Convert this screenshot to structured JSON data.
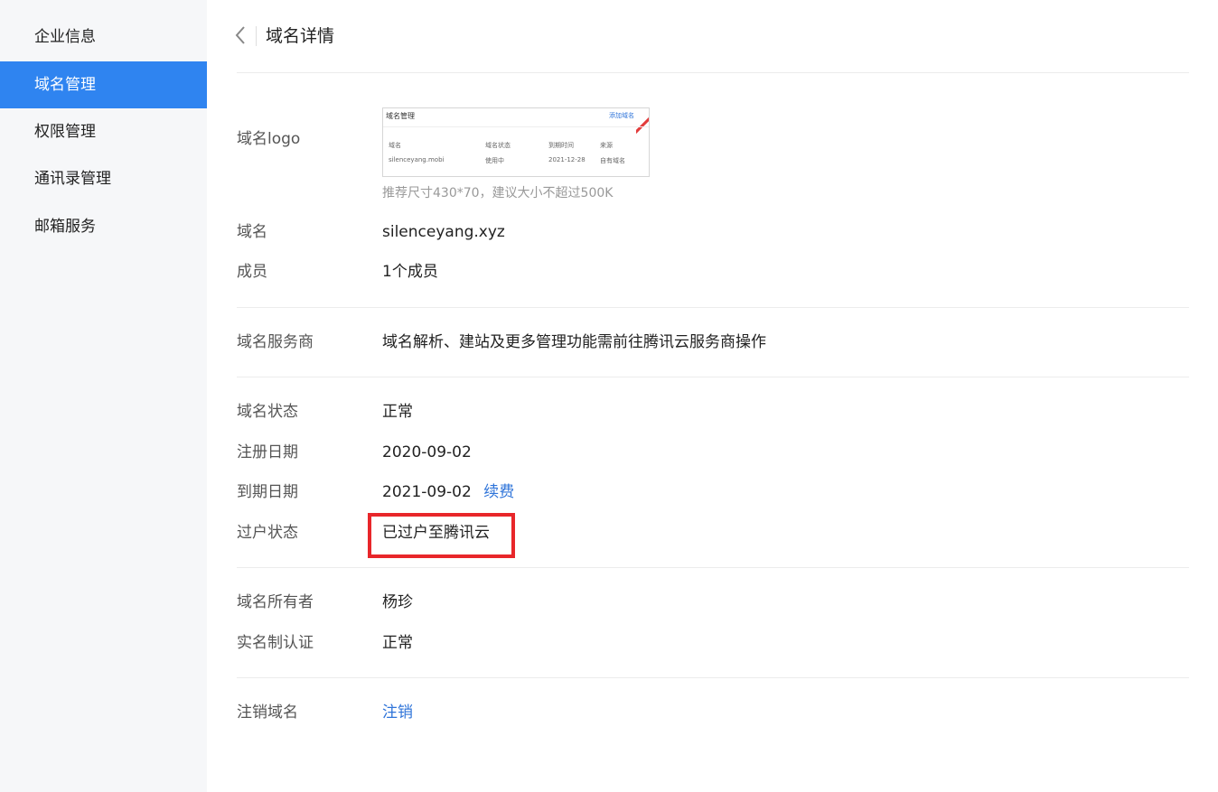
{
  "sidebar": {
    "items": [
      {
        "label": "企业信息",
        "active": false
      },
      {
        "label": "域名管理",
        "active": true
      },
      {
        "label": "权限管理",
        "active": false
      },
      {
        "label": "通讯录管理",
        "active": false
      },
      {
        "label": "邮箱服务",
        "active": false
      }
    ]
  },
  "header": {
    "title": "域名详情"
  },
  "logo": {
    "label": "域名logo",
    "hint": "推荐尺寸430*70，建议大小不超过500K",
    "thumbnail": {
      "title": "域名管理",
      "add_label": "添加域名",
      "columns": [
        "域名",
        "域名状态",
        "到期时间",
        "来源"
      ],
      "row": [
        "silenceyang.mobi",
        "使用中",
        "2021-12-28",
        "自有域名"
      ]
    }
  },
  "basic": {
    "domain_label": "域名",
    "domain_value": "silenceyang.xyz",
    "members_label": "成员",
    "members_value": "1个成员"
  },
  "provider": {
    "label": "域名服务商",
    "value": "域名解析、建站及更多管理功能需前往腾讯云服务商操作"
  },
  "status": {
    "status_label": "域名状态",
    "status_value": "正常",
    "reg_label": "注册日期",
    "reg_value": "2020-09-02",
    "exp_label": "到期日期",
    "exp_value": "2021-09-02",
    "renew_label": "续费",
    "transfer_label": "过户状态",
    "transfer_value": "已过户至腾讯云"
  },
  "owner": {
    "owner_label": "域名所有者",
    "owner_value": "杨珍",
    "auth_label": "实名制认证",
    "auth_value": "正常"
  },
  "cancel": {
    "label": "注销域名",
    "action": "注销"
  },
  "colors": {
    "accent": "#2f84f0",
    "link": "#2f74d9",
    "highlight": "#e8262a"
  }
}
